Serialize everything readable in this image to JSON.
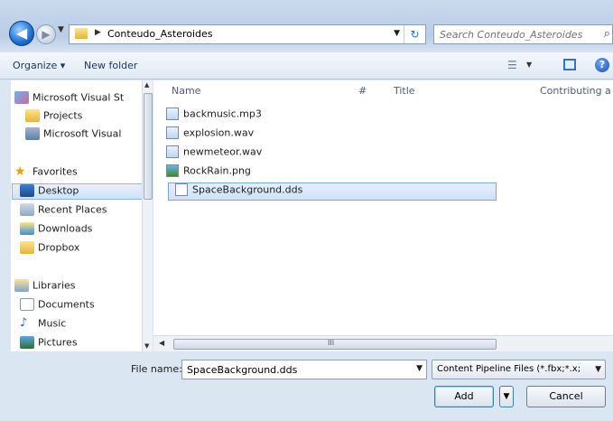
{
  "address": {
    "path": "Conteudo_Asteroides",
    "search_placeholder": "Search Conteudo_Asteroides"
  },
  "toolbar": {
    "organize_label": "Organize ▾",
    "new_folder_label": "New folder"
  },
  "nav": {
    "items": [
      {
        "label": "Microsoft Visual St"
      },
      {
        "label": "Projects"
      },
      {
        "label": "Microsoft Visual"
      },
      {
        "label": "Favorites"
      },
      {
        "label": "Desktop"
      },
      {
        "label": "Recent Places"
      },
      {
        "label": "Downloads"
      },
      {
        "label": "Dropbox"
      },
      {
        "label": "Libraries"
      },
      {
        "label": "Documents"
      },
      {
        "label": "Music"
      },
      {
        "label": "Pictures"
      }
    ]
  },
  "columns": {
    "name": "Name",
    "number": "#",
    "title": "Title",
    "contributing": "Contributing a"
  },
  "files": [
    {
      "name": "backmusic.mp3",
      "icon": "audio-file-icon"
    },
    {
      "name": "explosion.wav",
      "icon": "audio-file-icon"
    },
    {
      "name": "newmeteor.wav",
      "icon": "audio-file-icon"
    },
    {
      "name": "RockRain.png",
      "icon": "image-file-icon"
    },
    {
      "name": "SpaceBackground.dds",
      "icon": "generic-file-icon"
    }
  ],
  "bottom": {
    "filename_label": "File name:",
    "filename_value": "SpaceBackground.dds",
    "filetype_value": "Content Pipeline Files (*.fbx;*.x;",
    "add_label": "Add",
    "cancel_label": "Cancel"
  },
  "scroll": {
    "grip": "III"
  }
}
